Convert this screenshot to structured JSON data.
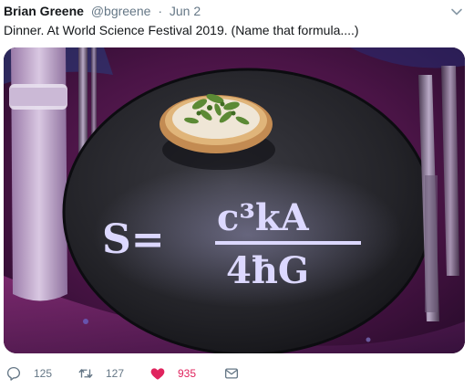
{
  "tweet": {
    "author_name": "Brian Greene",
    "handle": "@bgreene",
    "separator": "·",
    "date": "Jun 2",
    "text": "Dinner. At World Science Festival 2019. (Name that formula....)"
  },
  "image": {
    "formula_left": "S=",
    "formula_numerator": "c³kA",
    "formula_denominator": "4ħG"
  },
  "actions": {
    "reply_count": "125",
    "retweet_count": "127",
    "like_count": "935"
  },
  "colors": {
    "like_active": "#e0245e",
    "muted": "#657786"
  }
}
